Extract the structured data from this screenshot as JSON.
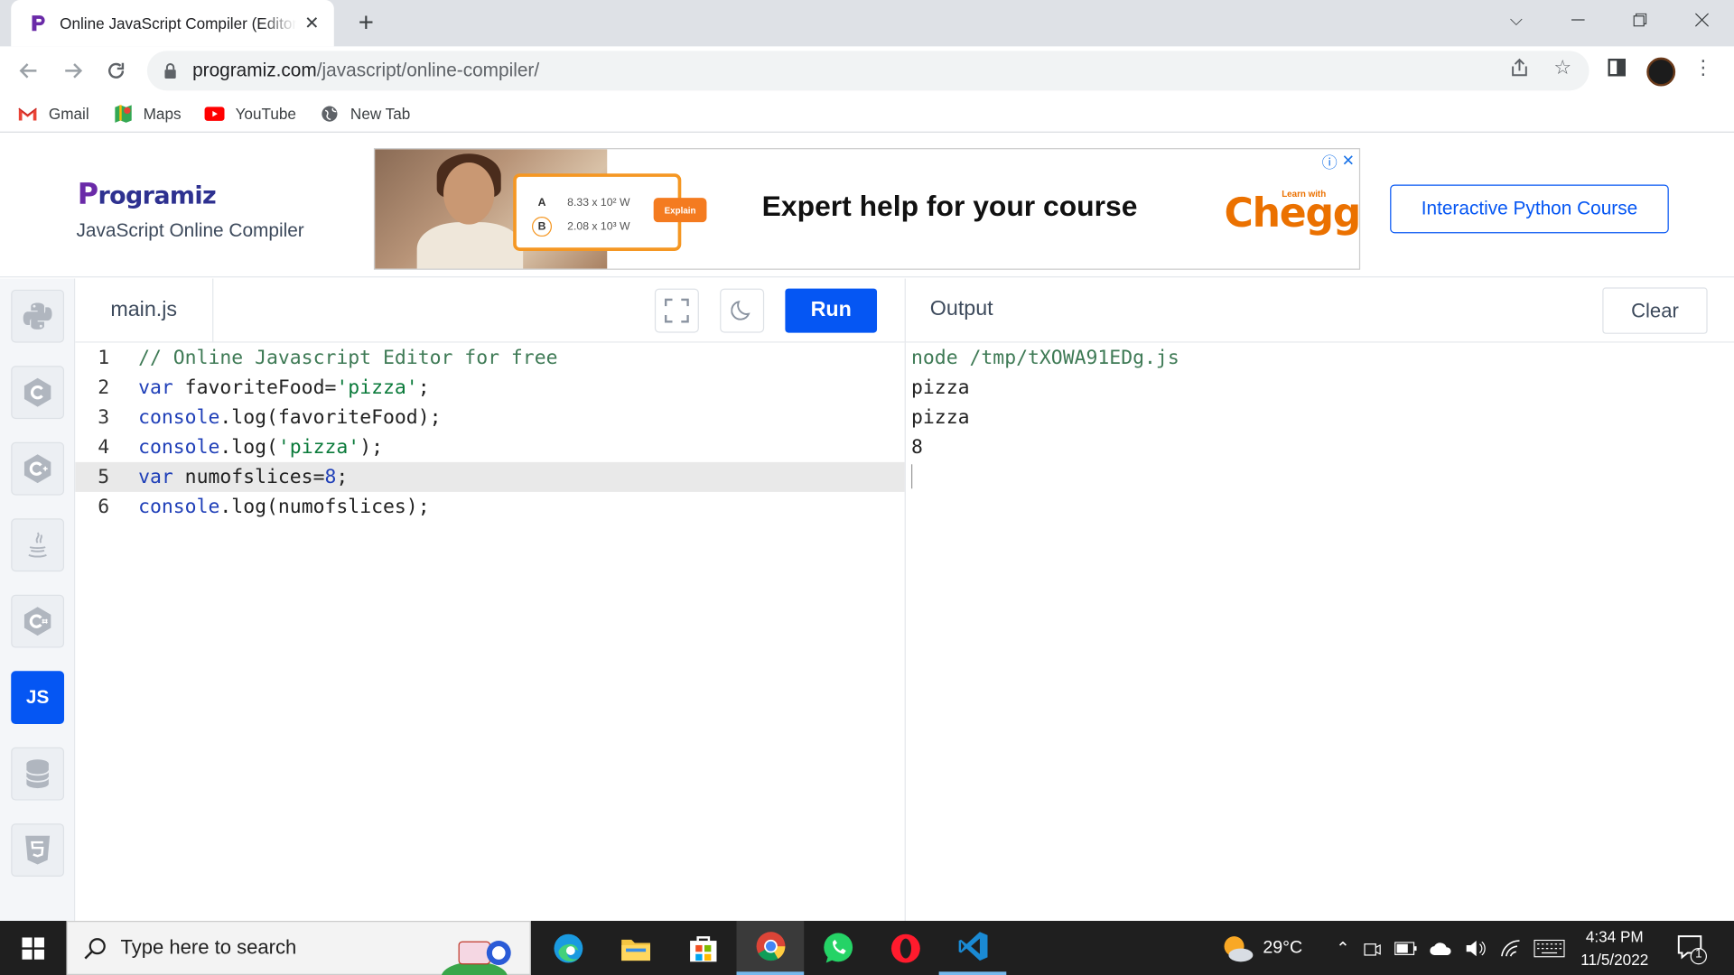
{
  "browser": {
    "tab_title": "Online JavaScript Compiler (Editor)",
    "new_tab_symbol": "+",
    "url_domain": "programiz.com",
    "url_path": "/javascript/online-compiler/",
    "bookmarks": [
      {
        "label": "Gmail",
        "icon": "gmail-icon"
      },
      {
        "label": "Maps",
        "icon": "maps-icon"
      },
      {
        "label": "YouTube",
        "icon": "youtube-icon"
      },
      {
        "label": "New Tab",
        "icon": "globe-icon"
      }
    ]
  },
  "site": {
    "logo": "rogramiz",
    "logo_letter": "P",
    "subtitle": "JavaScript Online Compiler",
    "course_button": "Interactive Python Course"
  },
  "ad": {
    "headline": "Expert help for your course",
    "brand": "Chegg",
    "brand_tagline": "Learn with",
    "option_a_label": "A",
    "option_a_value": "8.33 x 10² W",
    "option_b_label": "B",
    "option_b_value": "2.08 x 10³ W",
    "explain": "Explain"
  },
  "rail": {
    "languages": [
      "python-icon",
      "c-icon",
      "cpp-icon",
      "java-icon",
      "csharp-icon",
      "javascript",
      "sql-icon",
      "html-icon"
    ],
    "active_label": "JS"
  },
  "editor": {
    "file_name": "main.js",
    "run_label": "Run",
    "highlighted_line": 5,
    "lines": [
      {
        "num": "1",
        "parts": [
          {
            "t": "// Online Javascript Editor for free",
            "c": "c"
          }
        ]
      },
      {
        "num": "2",
        "parts": [
          {
            "t": "var",
            "c": "k"
          },
          {
            "t": " favoriteFood=",
            "c": ""
          },
          {
            "t": "'pizza'",
            "c": "s"
          },
          {
            "t": ";",
            "c": ""
          }
        ]
      },
      {
        "num": "3",
        "parts": [
          {
            "t": "console",
            "c": "k"
          },
          {
            "t": ".log(favoriteFood);",
            "c": ""
          }
        ]
      },
      {
        "num": "4",
        "parts": [
          {
            "t": "console",
            "c": "k"
          },
          {
            "t": ".log(",
            "c": ""
          },
          {
            "t": "'pizza'",
            "c": "s"
          },
          {
            "t": ");",
            "c": ""
          }
        ]
      },
      {
        "num": "5",
        "parts": [
          {
            "t": "var",
            "c": "k"
          },
          {
            "t": " numofslices=",
            "c": ""
          },
          {
            "t": "8",
            "c": "n"
          },
          {
            "t": ";",
            "c": ""
          }
        ]
      },
      {
        "num": "6",
        "parts": [
          {
            "t": "console",
            "c": "k"
          },
          {
            "t": ".log(numofslices);",
            "c": ""
          }
        ]
      }
    ]
  },
  "output": {
    "title": "Output",
    "clear_label": "Clear",
    "command": "node /tmp/tXOWA91EDg.js",
    "lines": [
      "pizza",
      "pizza",
      "8"
    ]
  },
  "taskbar": {
    "search_placeholder": "Type here to search",
    "weather": "29°C",
    "time": "4:34 PM",
    "date": "11/5/2022",
    "notification_count": "1"
  }
}
